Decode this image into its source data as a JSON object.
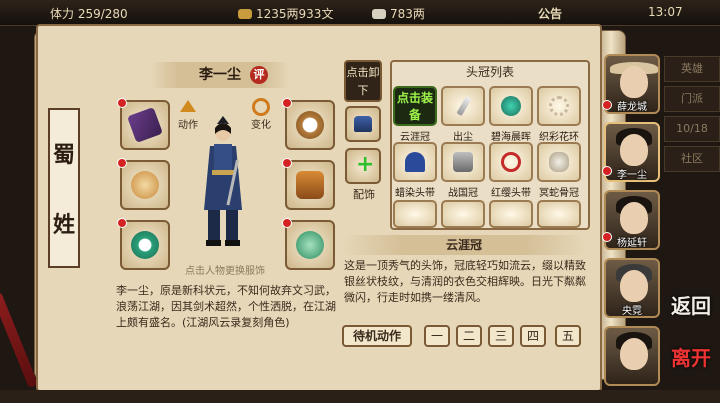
{
  "topbar": {
    "stat": "体力 259/280",
    "money": "1235两933文",
    "silver": "783两",
    "notice": "公告",
    "clock": "13:07"
  },
  "scroll_title": [
    "蜀",
    "姓"
  ],
  "character": {
    "name": "李一尘",
    "rating": "评",
    "action_left": "动作",
    "action_right": "变化",
    "hint": "点击人物更换服饰",
    "description": "李一尘，原是新科状元，不知何故弃文习武，浪荡江湖，因其剑术超然，个性洒脱，在江湖上颇有盛名。(江湖风云录复刻角色)"
  },
  "mini_column": {
    "unequip": "点击卸下",
    "accessory": "配饰"
  },
  "headwear": {
    "title": "头冠列表",
    "equip_button": "点击装备",
    "items": [
      {
        "label": "云涯冠",
        "icon": "cloud-crown-icon"
      },
      {
        "label": "出尘",
        "icon": "hairpin-icon"
      },
      {
        "label": "碧海晨晖",
        "icon": "jade-ornament-icon"
      },
      {
        "label": "织彩花环",
        "icon": "flower-wreath-icon"
      },
      {
        "label": "蜡染头带",
        "icon": "blue-headband-icon"
      },
      {
        "label": "战国冠",
        "icon": "war-helmet-icon"
      },
      {
        "label": "红缨头带",
        "icon": "red-tassel-headband-icon"
      },
      {
        "label": "冥蛇骨冠",
        "icon": "bone-crown-icon"
      }
    ]
  },
  "detail": {
    "title": "云涯冠",
    "text": "这是一顶秀气的头饰，冠底轻巧如流云，缀以精致银丝状枝纹，与清润的衣色交相辉映。日光下粼粼微闪，行走时如携一缕清风。"
  },
  "idle": {
    "label": "待机动作",
    "options": [
      "一",
      "二",
      "三",
      "四",
      "五"
    ]
  },
  "portraits": [
    {
      "name": "薛龙城"
    },
    {
      "name": "李一尘"
    },
    {
      "name": "杨延轩"
    },
    {
      "name": "央霓"
    },
    {
      "name": ""
    }
  ],
  "side_tabs": [
    "英雄",
    "门派",
    "10/18",
    "社区"
  ],
  "nav": {
    "back": "返回",
    "leave": "离开"
  },
  "colors": {
    "parchment": "#e6d7b8",
    "frame": "#8a6a45",
    "equip_green": "#9ef44a",
    "alert_red": "#d42121"
  }
}
